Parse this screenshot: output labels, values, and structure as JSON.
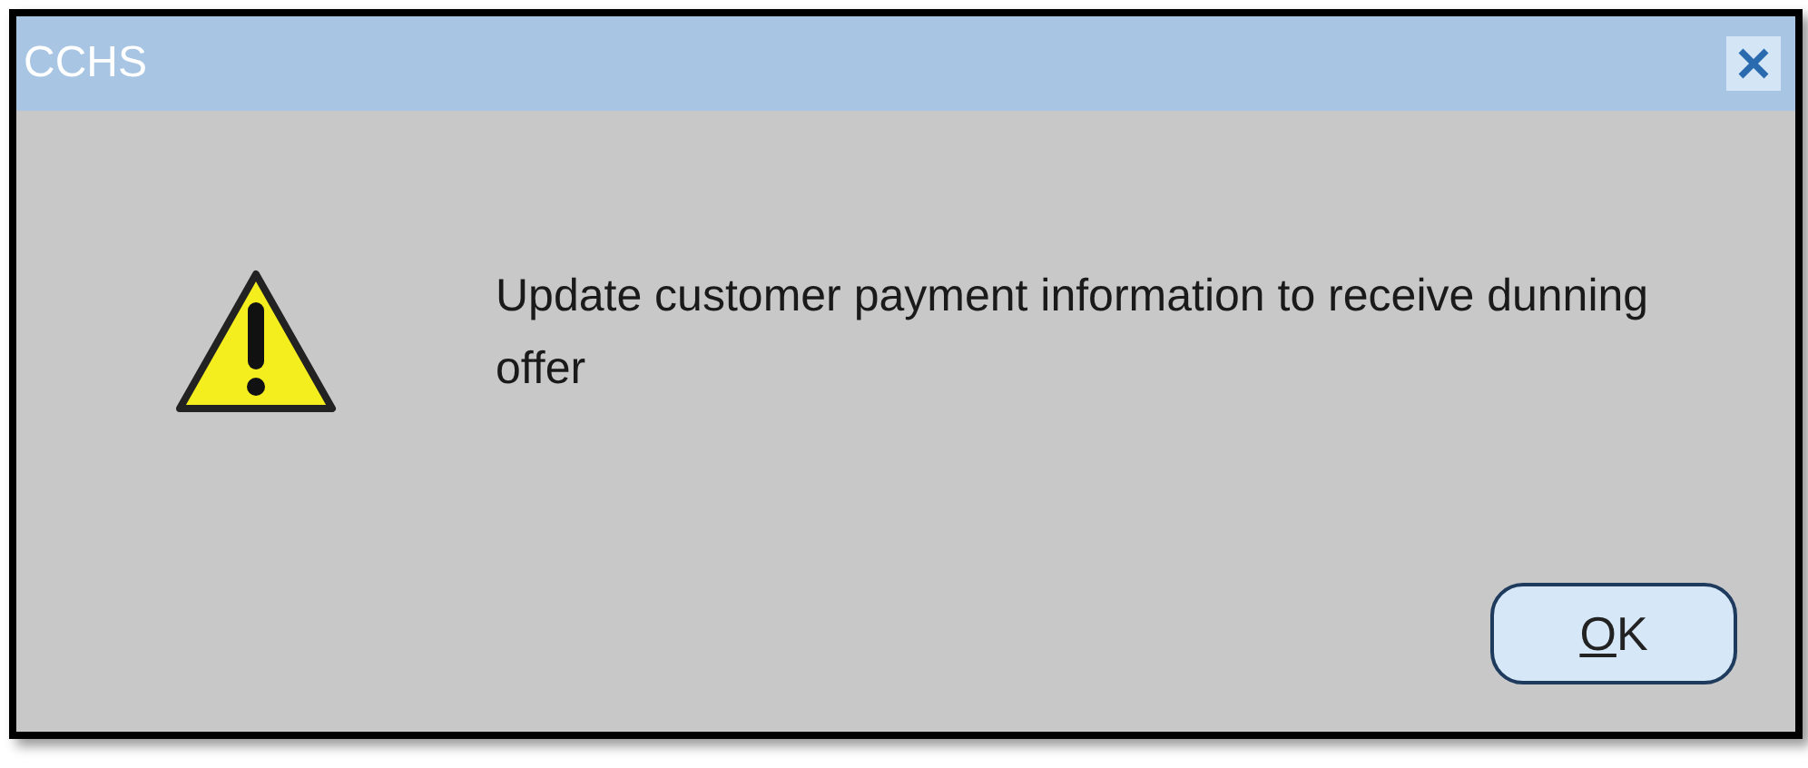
{
  "window": {
    "title": "CCHS"
  },
  "message": "Update customer payment information to receive dunning offer",
  "buttons": [
    {
      "label": "OK",
      "mnemonic": true
    }
  ]
}
